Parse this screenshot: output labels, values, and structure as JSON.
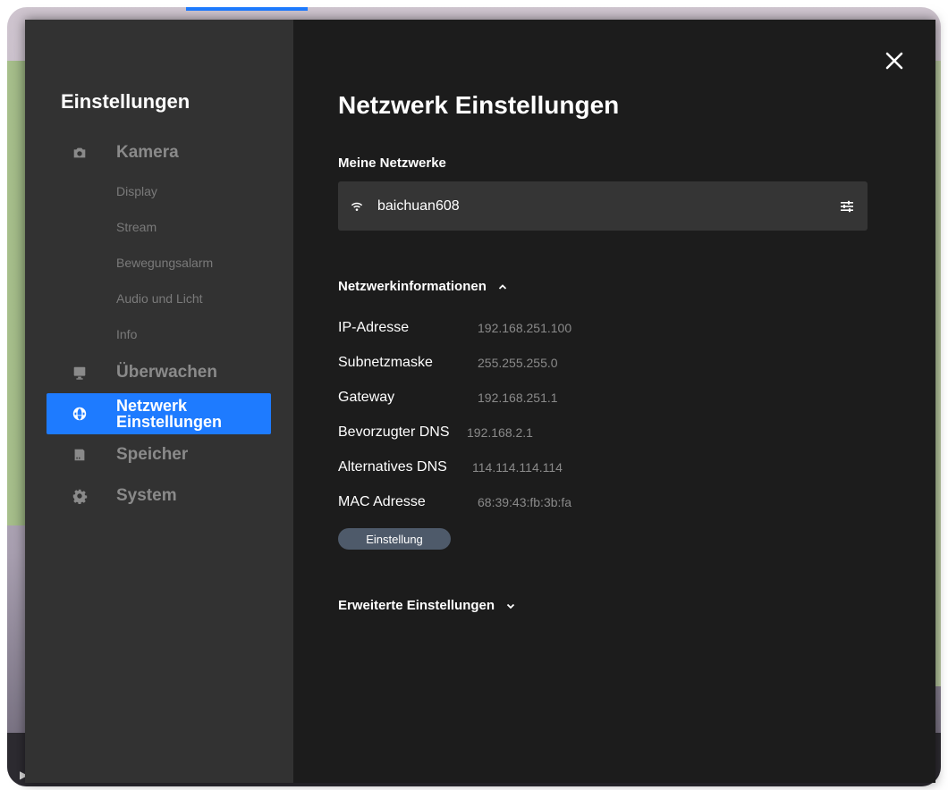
{
  "sidebar": {
    "title": "Einstellungen",
    "kamera": {
      "label": "Kamera",
      "icon": "camera-icon"
    },
    "subitems": [
      {
        "label": "Display"
      },
      {
        "label": "Stream"
      },
      {
        "label": "Bewegungsalarm"
      },
      {
        "label": "Audio und Licht"
      },
      {
        "label": "Info"
      }
    ],
    "ueberwachen": {
      "label": "Überwachen",
      "icon": "monitor-icon"
    },
    "netzwerk": {
      "label": "Netzwerk Einstellungen",
      "icon": "globe-icon"
    },
    "speicher": {
      "label": "Speicher",
      "icon": "storage-icon"
    },
    "system": {
      "label": "System",
      "icon": "gear-icon"
    }
  },
  "main": {
    "title": "Netzwerk Einstellungen",
    "my_networks_title": "Meine Netzwerke",
    "network_name": "baichuan608",
    "info_title": "Netzwerkinformationen",
    "info": [
      {
        "key": "IP-Adresse",
        "value": "192.168.251.100"
      },
      {
        "key": "Subnetzmaske",
        "value": "255.255.255.0"
      },
      {
        "key": "Gateway",
        "value": "192.168.251.1"
      },
      {
        "key": "Bevorzugter DNS",
        "value": "192.168.2.1"
      },
      {
        "key": "Alternatives DNS",
        "value": "114.114.114.114"
      },
      {
        "key": "MAC Adresse",
        "value": "68:39:43:fb:3b:fa"
      }
    ],
    "settings_button": "Einstellung",
    "advanced_title": "Erweiterte Einstellungen"
  },
  "colors": {
    "accent": "#1e7bff",
    "sidebar_bg": "#323232",
    "content_bg": "#1c1c1c"
  }
}
